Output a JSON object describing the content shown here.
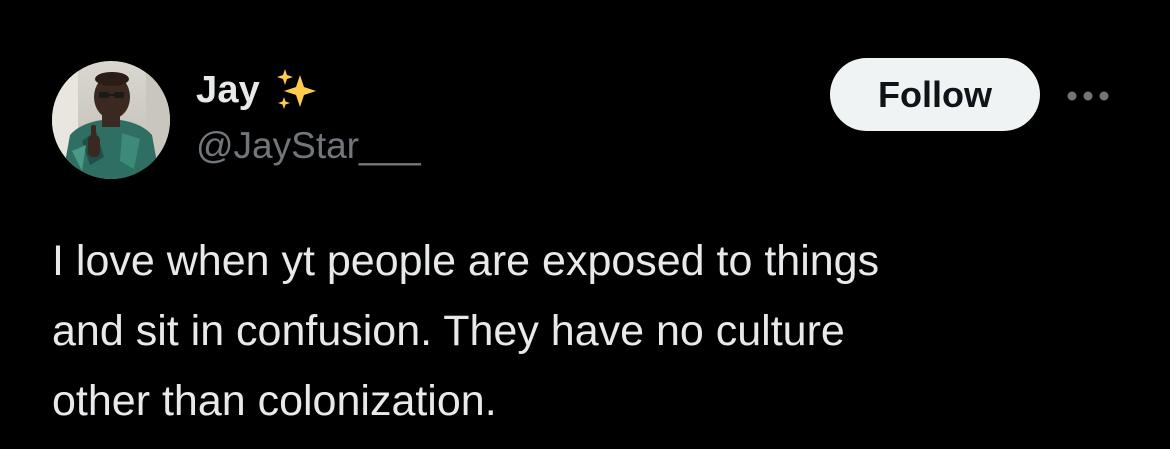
{
  "author": {
    "display_name": "Jay",
    "handle": "@JayStar___",
    "badge_icon": "sparkles-icon",
    "avatar_icon": "avatar-photo"
  },
  "actions": {
    "follow_label": "Follow",
    "more_icon": "more-options-icon"
  },
  "tweet": {
    "text": "I love when yt people are exposed to things\nand sit in confusion. They have no culture\nother than colonization."
  },
  "colors": {
    "background": "#000000",
    "text_primary": "#e7e9ea",
    "text_secondary": "#71767b",
    "follow_button_bg": "#eff3f4",
    "follow_button_text": "#0f1419",
    "sparkle": "#ffcc4d"
  }
}
